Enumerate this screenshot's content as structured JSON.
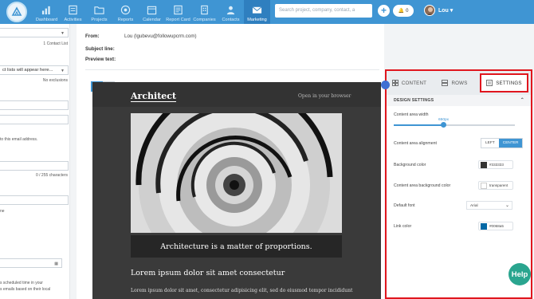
{
  "nav": {
    "items": [
      {
        "label": "Dashboard",
        "icon": "dashboard-icon"
      },
      {
        "label": "Activities",
        "icon": "activities-icon"
      },
      {
        "label": "Projects",
        "icon": "folder-icon"
      },
      {
        "label": "Reports",
        "icon": "reports-icon"
      },
      {
        "label": "Calendar",
        "icon": "calendar-icon"
      },
      {
        "label": "Report Card",
        "icon": "report-card-icon"
      },
      {
        "label": "Companies",
        "icon": "companies-icon"
      },
      {
        "label": "Contacts",
        "icon": "contacts-icon"
      },
      {
        "label": "Marketing",
        "icon": "envelope-icon"
      }
    ],
    "active": "Marketing",
    "search_placeholder": "Search project, company, contact, a",
    "notifications": "0",
    "user": "Lou"
  },
  "left_panel": {
    "contact_list_count": "1 Contact List",
    "lists_placeholder": "ct lists will appear here...",
    "no_exclusions": "No exclusions",
    "email_note": "to this email address.",
    "char_count": "0 / 255 characters",
    "short_note": "ne",
    "schedule_note_1": "s scheduled time in your",
    "schedule_note_2": "s emails based on their local"
  },
  "email_meta": {
    "from_label": "From:",
    "from_value": "Lou (lgubevu@followupcrm.com)",
    "subject_label": "Subject line:",
    "preview_label": "Preview text:"
  },
  "preview": {
    "logo": "Architect",
    "open_browser": "Open in your browser",
    "caption": "Architecture is a matter of proportions.",
    "heading": "Lorem ipsum dolor sit amet consectetur",
    "body": "Lorem ipsum dolor sit amet, consectetur adipisicing elit, sed do eiusmod tempor incididunt"
  },
  "settings_panel": {
    "tabs": [
      {
        "label": "CONTENT",
        "icon": "content-grid-icon"
      },
      {
        "label": "ROWS",
        "icon": "rows-icon"
      },
      {
        "label": "SETTINGS",
        "icon": "settings-doc-icon"
      }
    ],
    "active_tab": "SETTINGS",
    "section_title": "DESIGN SETTINGS",
    "content_width_label": "Content area width",
    "content_width_value": "650px",
    "content_width_fraction": 0.41,
    "alignment_label": "Content area alignment",
    "align_left": "LEFT",
    "align_center": "CENTER",
    "background_color_label": "Background color",
    "background_color": "#333333",
    "content_bg_label": "Content area background color",
    "content_bg_value": "transparent",
    "default_font_label": "Default font",
    "default_font": "Arial",
    "link_color_label": "Link color",
    "link_color": "#0068a5"
  },
  "help_label": "Help",
  "colors": {
    "nav_blue": "#3f95d3",
    "highlight_red": "#e0161e",
    "help_green": "#2aa58f"
  }
}
